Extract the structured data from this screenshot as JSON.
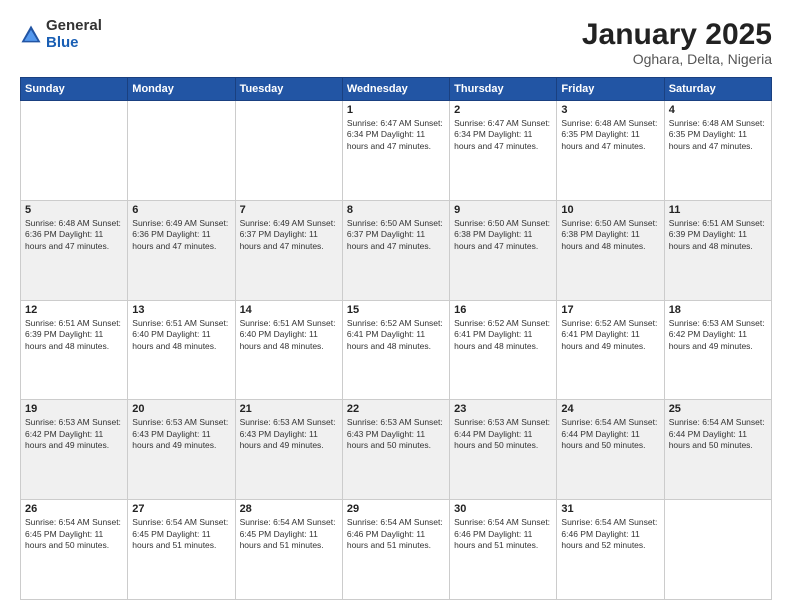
{
  "header": {
    "logo_general": "General",
    "logo_blue": "Blue",
    "title": "January 2025",
    "subtitle": "Oghara, Delta, Nigeria"
  },
  "weekdays": [
    "Sunday",
    "Monday",
    "Tuesday",
    "Wednesday",
    "Thursday",
    "Friday",
    "Saturday"
  ],
  "weeks": [
    [
      {
        "day": "",
        "info": ""
      },
      {
        "day": "",
        "info": ""
      },
      {
        "day": "",
        "info": ""
      },
      {
        "day": "1",
        "info": "Sunrise: 6:47 AM\nSunset: 6:34 PM\nDaylight: 11 hours and 47 minutes."
      },
      {
        "day": "2",
        "info": "Sunrise: 6:47 AM\nSunset: 6:34 PM\nDaylight: 11 hours and 47 minutes."
      },
      {
        "day": "3",
        "info": "Sunrise: 6:48 AM\nSunset: 6:35 PM\nDaylight: 11 hours and 47 minutes."
      },
      {
        "day": "4",
        "info": "Sunrise: 6:48 AM\nSunset: 6:35 PM\nDaylight: 11 hours and 47 minutes."
      }
    ],
    [
      {
        "day": "5",
        "info": "Sunrise: 6:48 AM\nSunset: 6:36 PM\nDaylight: 11 hours and 47 minutes."
      },
      {
        "day": "6",
        "info": "Sunrise: 6:49 AM\nSunset: 6:36 PM\nDaylight: 11 hours and 47 minutes."
      },
      {
        "day": "7",
        "info": "Sunrise: 6:49 AM\nSunset: 6:37 PM\nDaylight: 11 hours and 47 minutes."
      },
      {
        "day": "8",
        "info": "Sunrise: 6:50 AM\nSunset: 6:37 PM\nDaylight: 11 hours and 47 minutes."
      },
      {
        "day": "9",
        "info": "Sunrise: 6:50 AM\nSunset: 6:38 PM\nDaylight: 11 hours and 47 minutes."
      },
      {
        "day": "10",
        "info": "Sunrise: 6:50 AM\nSunset: 6:38 PM\nDaylight: 11 hours and 48 minutes."
      },
      {
        "day": "11",
        "info": "Sunrise: 6:51 AM\nSunset: 6:39 PM\nDaylight: 11 hours and 48 minutes."
      }
    ],
    [
      {
        "day": "12",
        "info": "Sunrise: 6:51 AM\nSunset: 6:39 PM\nDaylight: 11 hours and 48 minutes."
      },
      {
        "day": "13",
        "info": "Sunrise: 6:51 AM\nSunset: 6:40 PM\nDaylight: 11 hours and 48 minutes."
      },
      {
        "day": "14",
        "info": "Sunrise: 6:51 AM\nSunset: 6:40 PM\nDaylight: 11 hours and 48 minutes."
      },
      {
        "day": "15",
        "info": "Sunrise: 6:52 AM\nSunset: 6:41 PM\nDaylight: 11 hours and 48 minutes."
      },
      {
        "day": "16",
        "info": "Sunrise: 6:52 AM\nSunset: 6:41 PM\nDaylight: 11 hours and 48 minutes."
      },
      {
        "day": "17",
        "info": "Sunrise: 6:52 AM\nSunset: 6:41 PM\nDaylight: 11 hours and 49 minutes."
      },
      {
        "day": "18",
        "info": "Sunrise: 6:53 AM\nSunset: 6:42 PM\nDaylight: 11 hours and 49 minutes."
      }
    ],
    [
      {
        "day": "19",
        "info": "Sunrise: 6:53 AM\nSunset: 6:42 PM\nDaylight: 11 hours and 49 minutes."
      },
      {
        "day": "20",
        "info": "Sunrise: 6:53 AM\nSunset: 6:43 PM\nDaylight: 11 hours and 49 minutes."
      },
      {
        "day": "21",
        "info": "Sunrise: 6:53 AM\nSunset: 6:43 PM\nDaylight: 11 hours and 49 minutes."
      },
      {
        "day": "22",
        "info": "Sunrise: 6:53 AM\nSunset: 6:43 PM\nDaylight: 11 hours and 50 minutes."
      },
      {
        "day": "23",
        "info": "Sunrise: 6:53 AM\nSunset: 6:44 PM\nDaylight: 11 hours and 50 minutes."
      },
      {
        "day": "24",
        "info": "Sunrise: 6:54 AM\nSunset: 6:44 PM\nDaylight: 11 hours and 50 minutes."
      },
      {
        "day": "25",
        "info": "Sunrise: 6:54 AM\nSunset: 6:44 PM\nDaylight: 11 hours and 50 minutes."
      }
    ],
    [
      {
        "day": "26",
        "info": "Sunrise: 6:54 AM\nSunset: 6:45 PM\nDaylight: 11 hours and 50 minutes."
      },
      {
        "day": "27",
        "info": "Sunrise: 6:54 AM\nSunset: 6:45 PM\nDaylight: 11 hours and 51 minutes."
      },
      {
        "day": "28",
        "info": "Sunrise: 6:54 AM\nSunset: 6:45 PM\nDaylight: 11 hours and 51 minutes."
      },
      {
        "day": "29",
        "info": "Sunrise: 6:54 AM\nSunset: 6:46 PM\nDaylight: 11 hours and 51 minutes."
      },
      {
        "day": "30",
        "info": "Sunrise: 6:54 AM\nSunset: 6:46 PM\nDaylight: 11 hours and 51 minutes."
      },
      {
        "day": "31",
        "info": "Sunrise: 6:54 AM\nSunset: 6:46 PM\nDaylight: 11 hours and 52 minutes."
      },
      {
        "day": "",
        "info": ""
      }
    ]
  ]
}
